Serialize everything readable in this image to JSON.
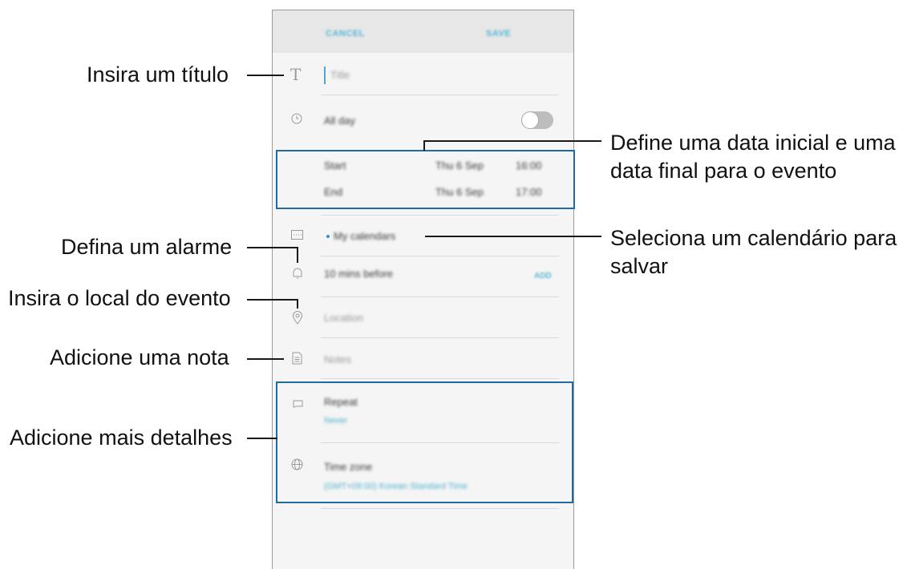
{
  "app": {
    "cancel": "CANCEL",
    "save": "SAVE",
    "title_placeholder": "Title",
    "all_day": "All day",
    "start": {
      "label": "Start",
      "date": "Thu 6 Sep",
      "time": "16:00"
    },
    "end": {
      "label": "End",
      "date": "Thu 6 Sep",
      "time": "17:00"
    },
    "calendar": "My calendars",
    "alarm": "10 mins before",
    "alarm_action": "ADD",
    "location": "Location",
    "notes": "Notes",
    "repeat": {
      "label": "Repeat",
      "value": "Never"
    },
    "timezone": {
      "label": "Time zone",
      "value": "(GMT+09:00) Korean Standard Time"
    }
  },
  "callouts": {
    "title": "Insira um título",
    "alarm": "Defina um alarme",
    "location": "Insira o local do evento",
    "note": "Adicione uma nota",
    "details": "Adicione mais detalhes",
    "dates_line1": "Define uma data inicial e uma",
    "dates_line2": "data final para o evento",
    "calendar_line1": "Seleciona um calendário para",
    "calendar_line2": "salvar"
  },
  "colors": {
    "accent": "#56b6d6",
    "callout_box": "#1a6ba8",
    "header_bg": "#e7e7e7"
  },
  "icons": [
    "title-icon",
    "clock-icon",
    "calendar-icon",
    "bell-icon",
    "location-pin-icon",
    "note-icon",
    "repeat-icon",
    "globe-icon"
  ]
}
